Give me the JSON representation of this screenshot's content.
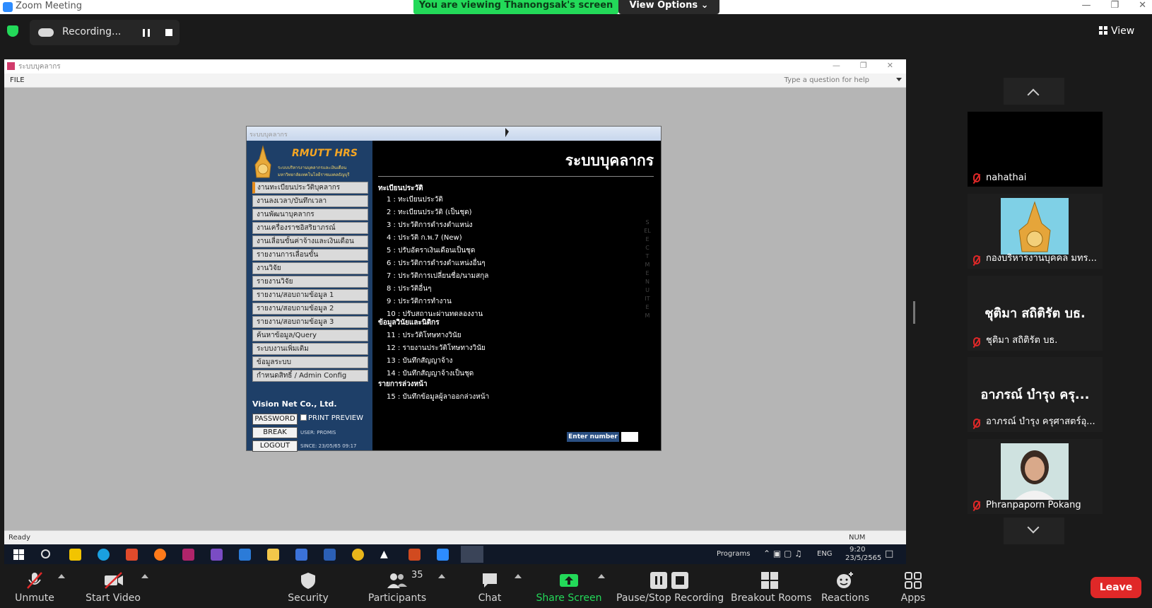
{
  "zoom": {
    "window_title": "Zoom Meeting",
    "viewing_banner": "You are viewing Thanongsak's screen",
    "view_options": "View Options",
    "recording_label": "Recording...",
    "view_label": "View"
  },
  "hrs": {
    "window_title": "ระบบบุคลากร",
    "menu_file": "FILE",
    "help_placeholder": "Type a question for help",
    "status_ready": "Ready",
    "status_num": "NUM",
    "dialog_title": "ระบบบุคลากร",
    "logo_title": "RMUTT HRS",
    "logo_line1": "ระบบบริหารงานบุคลากรและเงินเดือน",
    "logo_line2": "มหาวิทยาลัยเทคโนโลยีราชมงคลธัญบุรี",
    "main_title": "ระบบบุคลากร",
    "side_menu": [
      "งานทะเบียนประวัติบุคลากร",
      "งานลงเวลา/บันทึกเวลา",
      "งานพัฒนาบุคลากร",
      "งานเครื่องราชอิสริยาภรณ์",
      "งานเลื่อนขั้นค่าจ้างและเงินเดือน",
      "รายงานการเลื่อนขั้น",
      "งานวิจัย",
      "รายงานวิจัย",
      "รายงาน/สอบถามข้อมูล 1",
      "รายงาน/สอบถามข้อมูล 2",
      "รายงาน/สอบถามข้อมูล 3",
      "ค้นหาข้อมูล/Query",
      "ระบบงานเพิ่มเติม",
      "ข้อมูลระบบ",
      "กำหนดสิทธิ์ / Admin Config"
    ],
    "company": "Vision Net Co., Ltd.",
    "btn_password": "PASSWORD",
    "print_preview": "PRINT PREVIEW",
    "btn_break": "BREAK",
    "btn_logout": "LOGOUT",
    "user_info": "USER: PROMIS",
    "since_info": "SINCE: 23/05/65 09:17",
    "section1": "ทะเบียนประวัติ",
    "section2": "ข้อมูลวินัยและนิติกร",
    "section3": "รายการล่วงหน้า",
    "items": [
      "1 : ทะเบียนประวัติ",
      "2 : ทะเบียนประวัติ (เป็นชุด)",
      "3 : ประวัติการดำรงตำแหน่ง",
      "4 : ประวัติ ก.พ.7 (New)",
      "5 : ปรับอัตราเงินเดือนเป็นชุด",
      "6 : ประวัติการดำรงตำแหน่งอื่นๆ",
      "7 : ประวัติการเปลี่ยนชื่อ/นามสกุล",
      "8 : ประวัติอื่นๆ",
      "9 : ประวัติการทำงาน",
      "10 : ปรับสถานะผ่านทดลองงาน",
      "11 : ประวัติโทษทางวินัย",
      "12 : รายงานประวัติโทษทางวินัย",
      "13 : บันทึกสัญญาจ้าง",
      "14 : บันทึกสัญญาจ้างเป็นชุด",
      "15 : บันทึกข้อมูลผู้ลาออกล่วงหน้า"
    ],
    "vertical_text": "SELECT MENU ITEM",
    "enter_number": "Enter number"
  },
  "taskbar": {
    "programs": "Programs",
    "lang": "ENG",
    "time": "9:20",
    "date": "23/5/2565"
  },
  "toolbar": {
    "unmute": "Unmute",
    "start_video": "Start Video",
    "security": "Security",
    "participants": "Participants",
    "participants_count": "35",
    "chat": "Chat",
    "share_screen": "Share Screen",
    "pause_stop_recording": "Pause/Stop Recording",
    "breakout_rooms": "Breakout Rooms",
    "reactions": "Reactions",
    "apps": "Apps",
    "leave": "Leave"
  },
  "participants": [
    {
      "name": "nahathai"
    },
    {
      "name": "กองบริหารงานบุคคล มทร..."
    },
    {
      "name": "ชุติมา สถิติรัต บธ.",
      "display": "ชุติมา สถิติรัต บธ."
    },
    {
      "name": "อาภรณ์ บำรุง ครุศาสตร์อุ...",
      "display": "อาภรณ์ บำรุง ครุ..."
    },
    {
      "name": "Phranpaporn Pokang"
    }
  ],
  "colors": {
    "zoom_green": "#23d959",
    "leave_red": "#e02828",
    "hrs_navy": "#1e3f68",
    "logo_orange": "#f5a623"
  }
}
